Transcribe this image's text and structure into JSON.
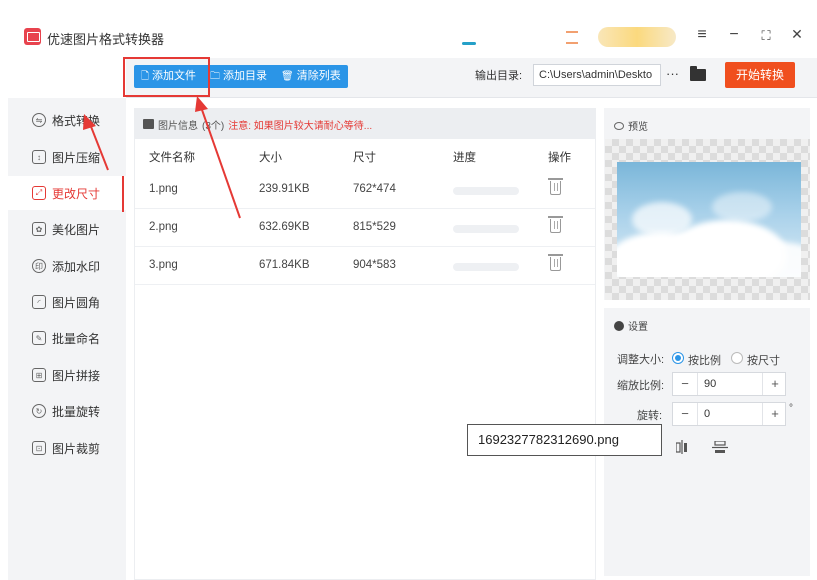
{
  "app": {
    "title": "优速图片格式转换器"
  },
  "window_controls": {
    "menu": "≡",
    "minimize": "−",
    "maximize": "⛶",
    "close": "✕"
  },
  "toolbar": {
    "add_file": "添加文件",
    "add_folder": "添加目录",
    "clear_list": "清除列表",
    "output_label": "输出目录:",
    "output_path": "C:\\Users\\admin\\Deskto",
    "more": "···",
    "start": "开始转换"
  },
  "sidebar": {
    "items": [
      {
        "label": "格式转换",
        "icon": "format-convert-icon",
        "glyph": "⇋"
      },
      {
        "label": "图片压缩",
        "icon": "compress-icon",
        "glyph": "↕"
      },
      {
        "label": "更改尺寸",
        "icon": "resize-icon",
        "glyph": "⤢"
      },
      {
        "label": "美化图片",
        "icon": "beautify-icon",
        "glyph": "✿"
      },
      {
        "label": "添加水印",
        "icon": "watermark-icon",
        "glyph": "印"
      },
      {
        "label": "图片圆角",
        "icon": "round-corner-icon",
        "glyph": "◜"
      },
      {
        "label": "批量命名",
        "icon": "rename-icon",
        "glyph": "✎"
      },
      {
        "label": "图片拼接",
        "icon": "stitch-icon",
        "glyph": "⊞"
      },
      {
        "label": "批量旋转",
        "icon": "rotate-icon",
        "glyph": "↻"
      },
      {
        "label": "图片裁剪",
        "icon": "crop-icon",
        "glyph": "⊡"
      }
    ],
    "active_index": 2
  },
  "file_panel": {
    "info_title": "图片信息",
    "info_count": "(3个)",
    "info_warning": "注意: 如果图片较大请耐心等待...",
    "columns": [
      "文件名称",
      "大小",
      "尺寸",
      "进度",
      "操作"
    ],
    "rows": [
      {
        "name": "1.png",
        "size": "239.91KB",
        "dimensions": "762*474",
        "progress": 0
      },
      {
        "name": "2.png",
        "size": "632.69KB",
        "dimensions": "815*529",
        "progress": 0
      },
      {
        "name": "3.png",
        "size": "671.84KB",
        "dimensions": "904*583",
        "progress": 0
      }
    ]
  },
  "preview": {
    "title": "预览"
  },
  "settings": {
    "title": "设置",
    "resize_label": "调整大小:",
    "by_ratio": "按比例",
    "by_size": "按尺寸",
    "resize_mode": "ratio",
    "scale_label": "缩放比例:",
    "scale_value": "90",
    "rotate_label": "旋转:",
    "rotate_value": "0",
    "degree": "°",
    "minus": "−",
    "plus": "+"
  },
  "tooltip": {
    "text": "1692327782312690.png"
  },
  "colors": {
    "accent_blue": "#2b95e7",
    "start_orange": "#f04f1e",
    "active_red": "#e53935"
  }
}
